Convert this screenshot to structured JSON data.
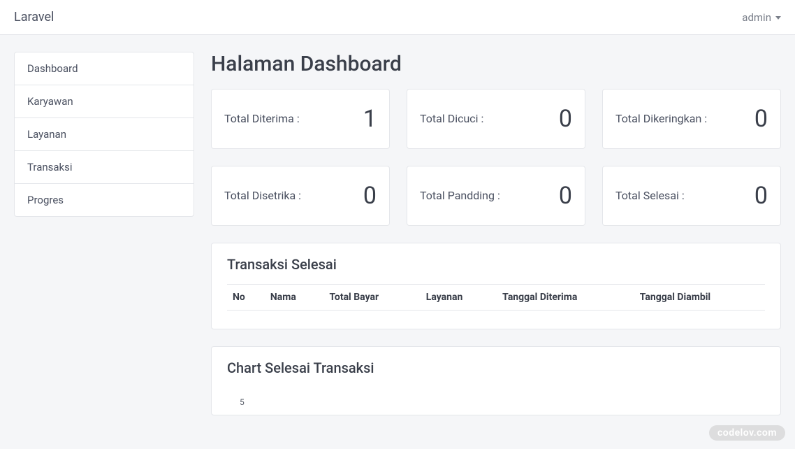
{
  "navbar": {
    "brand": "Laravel",
    "user": "admin"
  },
  "sidebar": {
    "items": [
      {
        "label": "Dashboard"
      },
      {
        "label": "Karyawan"
      },
      {
        "label": "Layanan"
      },
      {
        "label": "Transaksi"
      },
      {
        "label": "Progres"
      }
    ]
  },
  "page_title": "Halaman Dashboard",
  "stats": [
    {
      "label": "Total Diterima :",
      "value": "1"
    },
    {
      "label": "Total Dicuci :",
      "value": "0"
    },
    {
      "label": "Total Dikeringkan :",
      "value": "0"
    },
    {
      "label": "Total Disetrika :",
      "value": "0"
    },
    {
      "label": "Total Pandding :",
      "value": "0"
    },
    {
      "label": "Total Selesai :",
      "value": "0"
    }
  ],
  "table": {
    "title": "Transaksi Selesai",
    "columns": [
      "No",
      "Nama",
      "Total Bayar",
      "Layanan",
      "Tanggal Diterima",
      "Tanggal Diambil"
    ],
    "rows": []
  },
  "chart_card": {
    "title": "Chart Selesai Transaksi"
  },
  "chart_data": {
    "type": "line",
    "title": "Chart Selesai Transaksi",
    "ylim": [
      0,
      5
    ],
    "y_ticks": [
      "5"
    ],
    "series": [],
    "categories": []
  },
  "watermark": "codelov.com"
}
